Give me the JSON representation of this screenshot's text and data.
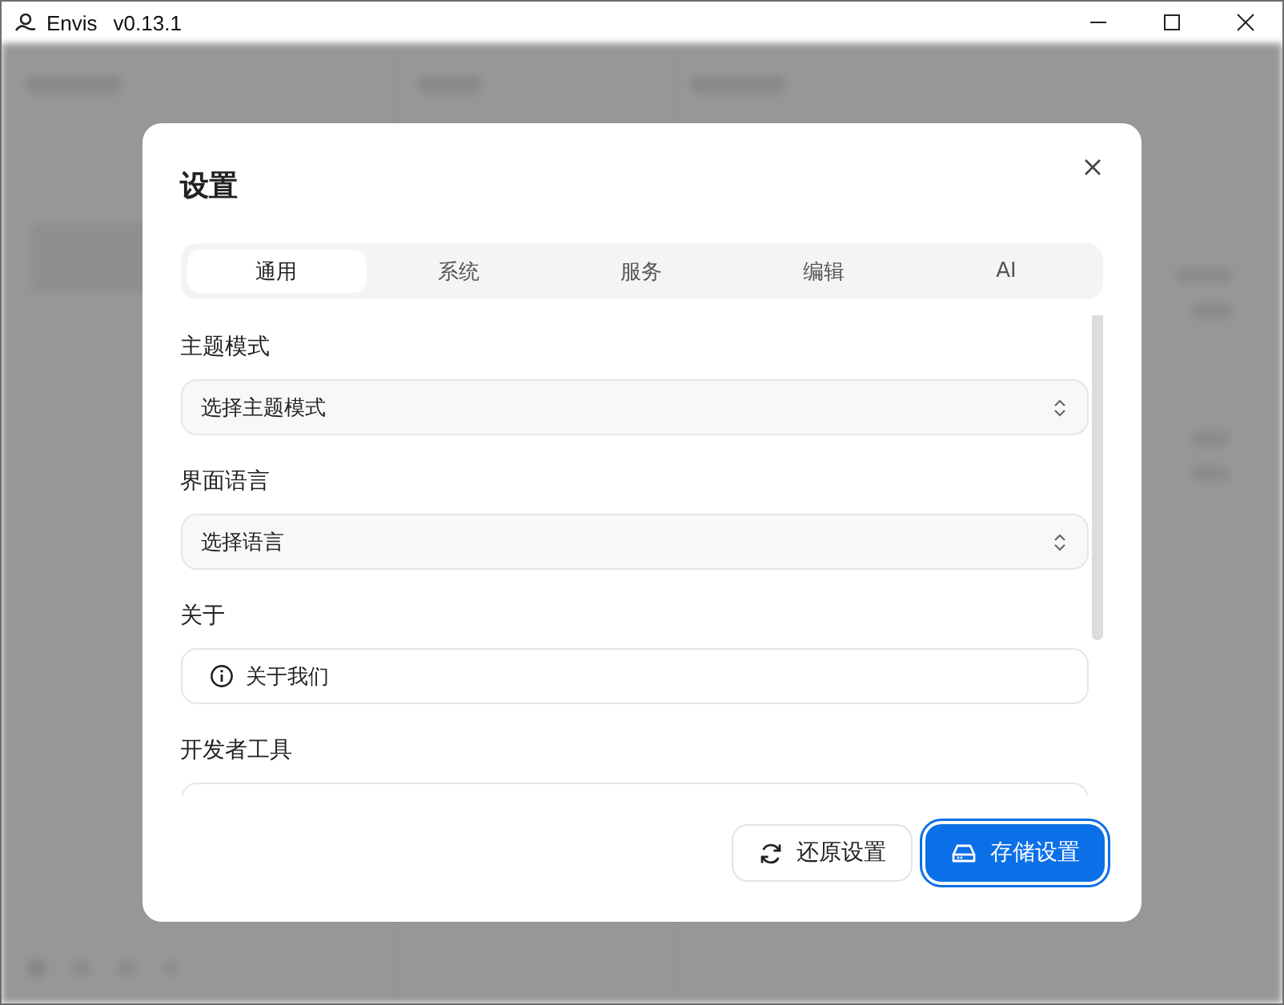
{
  "window": {
    "title": "Envis",
    "version": "v0.13.1"
  },
  "dialog": {
    "title": "设置",
    "tabs": [
      {
        "label": "通用",
        "selected": true
      },
      {
        "label": "系统",
        "selected": false
      },
      {
        "label": "服务",
        "selected": false
      },
      {
        "label": "编辑",
        "selected": false
      },
      {
        "label": "AI",
        "selected": false
      }
    ],
    "sections": [
      {
        "label": "主题模式",
        "kind": "select",
        "placeholder": "选择主题模式"
      },
      {
        "label": "界面语言",
        "kind": "select",
        "placeholder": "选择语言"
      },
      {
        "label": "关于",
        "kind": "button",
        "text": "关于我们"
      },
      {
        "label": "开发者工具",
        "kind": "button"
      }
    ],
    "buttons": [
      {
        "label": "还原设置",
        "kind": "reset"
      },
      {
        "label": "存储设置",
        "kind": "save"
      }
    ]
  }
}
